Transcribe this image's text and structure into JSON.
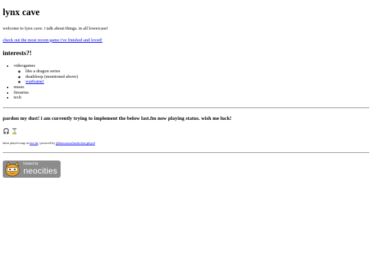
{
  "site": {
    "title": "lynx cave",
    "welcome": "welcome to lynx cave. i talk about things. in all lowercase!",
    "recent_game_link": "check out the most recent game i've finished and loved!"
  },
  "interests": {
    "heading": "interests?!",
    "items": [
      {
        "label": "videogames",
        "sub": [
          "like a dragon series",
          "deathloop (mentioned above)",
          "warframe!"
        ]
      },
      {
        "label": "music"
      },
      {
        "label": "firearms"
      },
      {
        "label": "tech"
      }
    ]
  },
  "notice": {
    "text": "pardon my dust! i am currently trying to implement the below last.fm now playing status. wish me luck!",
    "now_playing_icons": "🎧 ⌛"
  },
  "footer_line": {
    "prefix": "latest played song on",
    "lastfm_link": "last.fm",
    "separator": "| powered by",
    "credit_link": "@biancarosa/lastfm-last-played"
  },
  "badge": {
    "hosted_by": "hosted by",
    "brand": "neocities",
    "colors": {
      "bg": "#8c8c8c",
      "cat": "#f5a623"
    }
  }
}
